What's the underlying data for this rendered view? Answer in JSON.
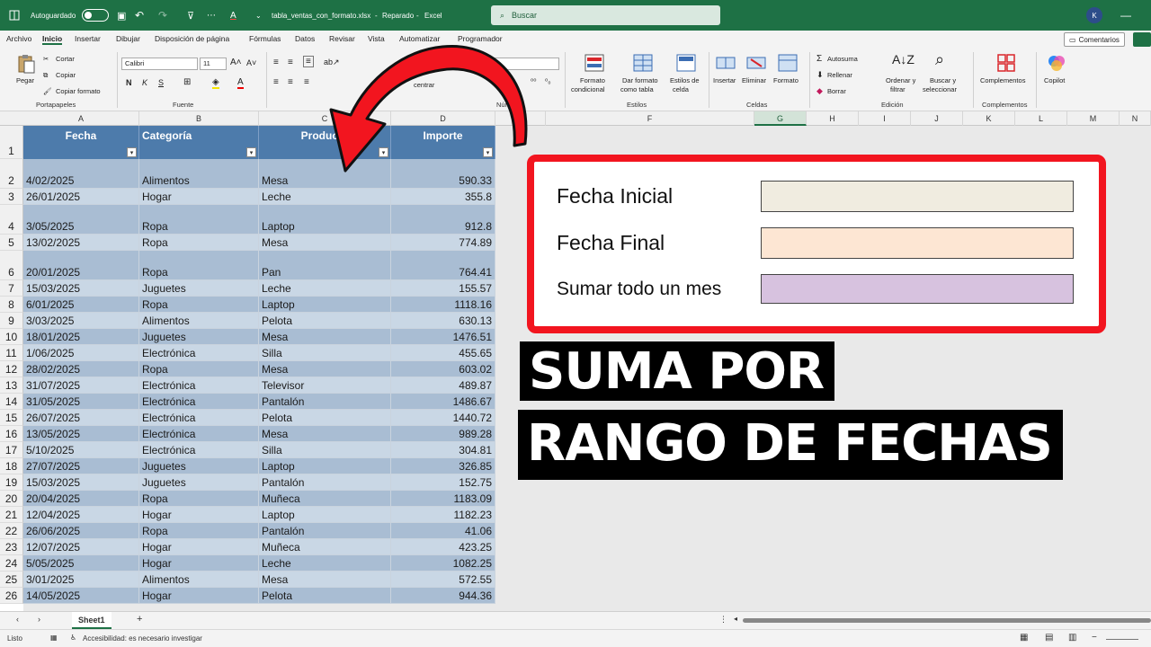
{
  "titlebar": {
    "autosave_label": "Autoguardado",
    "filename": "tabla_ventas_con_formato.xlsx",
    "status": "Reparado",
    "app": "Excel",
    "search_placeholder": "Buscar",
    "avatar_initial": "K"
  },
  "menu": {
    "tabs": [
      "Archivo",
      "Inicio",
      "Insertar",
      "Dibujar",
      "Disposición de página",
      "Fórmulas",
      "Datos",
      "Revisar",
      "Vista",
      "Automatizar",
      "Programador"
    ],
    "active": "Inicio",
    "comments_label": "Comentarios"
  },
  "ribbon": {
    "paste": "Pegar",
    "cut": "Cortar",
    "copy": "Copiar",
    "format_painter": "Copiar formato",
    "clipboard_group": "Portapapeles",
    "font_name": "Calibri",
    "font_size": "11",
    "font_group": "Fuente",
    "align_center_label": "centrar",
    "number_format": "General",
    "number_group": "Número",
    "cond_format_1": "Formato",
    "cond_format_2": "condicional",
    "format_table_1": "Dar formato",
    "format_table_2": "como tabla",
    "cell_styles_1": "Estilos de",
    "cell_styles_2": "celda",
    "styles_group": "Estilos",
    "insert": "Insertar",
    "delete": "Eliminar",
    "format": "Formato",
    "cells_group": "Celdas",
    "autosum": "Autosuma",
    "fill": "Rellenar",
    "clear": "Borrar",
    "sort_1": "Ordenar y",
    "sort_2": "filtrar",
    "find_1": "Buscar y",
    "find_2": "seleccionar",
    "edit_group": "Edición",
    "addins": "Complementos",
    "addins_group": "Complementos",
    "copilot": "Copilot"
  },
  "columns": [
    "A",
    "B",
    "C",
    "D",
    "E",
    "F",
    "G",
    "H",
    "I",
    "J",
    "K",
    "L",
    "M",
    "N"
  ],
  "selected_column": "G",
  "table": {
    "headers": [
      "Fecha",
      "Categoría",
      "Producto",
      "Importe"
    ],
    "rows": [
      [
        "4/02/2025",
        "Alimentos",
        "Mesa",
        "590.33"
      ],
      [
        "26/01/2025",
        "Hogar",
        "Leche",
        "355.8"
      ],
      [
        "3/05/2025",
        "Ropa",
        "Laptop",
        "912.8"
      ],
      [
        "13/02/2025",
        "Ropa",
        "Mesa",
        "774.89"
      ],
      [
        "20/01/2025",
        "Ropa",
        "Pan",
        "764.41"
      ],
      [
        "15/03/2025",
        "Juguetes",
        "Leche",
        "155.57"
      ],
      [
        "6/01/2025",
        "Ropa",
        "Laptop",
        "1118.16"
      ],
      [
        "3/03/2025",
        "Alimentos",
        "Pelota",
        "630.13"
      ],
      [
        "18/01/2025",
        "Juguetes",
        "Mesa",
        "1476.51"
      ],
      [
        "1/06/2025",
        "Electrónica",
        "Silla",
        "455.65"
      ],
      [
        "28/02/2025",
        "Ropa",
        "Mesa",
        "603.02"
      ],
      [
        "31/07/2025",
        "Electrónica",
        "Televisor",
        "489.87"
      ],
      [
        "31/05/2025",
        "Electrónica",
        "Pantalón",
        "1486.67"
      ],
      [
        "26/07/2025",
        "Electrónica",
        "Pelota",
        "1440.72"
      ],
      [
        "13/05/2025",
        "Electrónica",
        "Mesa",
        "989.28"
      ],
      [
        "5/10/2025",
        "Electrónica",
        "Silla",
        "304.81"
      ],
      [
        "27/07/2025",
        "Juguetes",
        "Laptop",
        "326.85"
      ],
      [
        "15/03/2025",
        "Juguetes",
        "Pantalón",
        "152.75"
      ],
      [
        "20/04/2025",
        "Ropa",
        "Muñeca",
        "1183.09"
      ],
      [
        "12/04/2025",
        "Hogar",
        "Laptop",
        "1182.23"
      ],
      [
        "26/06/2025",
        "Ropa",
        "Pantalón",
        "41.06"
      ],
      [
        "12/07/2025",
        "Hogar",
        "Muñeca",
        "423.25"
      ],
      [
        "5/05/2025",
        "Hogar",
        "Leche",
        "1082.25"
      ],
      [
        "3/01/2025",
        "Alimentos",
        "Mesa",
        "572.55"
      ],
      [
        "14/05/2025",
        "Hogar",
        "Pelota",
        "944.36"
      ]
    ]
  },
  "row_numbers": [
    "1",
    "2",
    "3",
    "4",
    "5",
    "6",
    "7",
    "8",
    "9",
    "10",
    "11",
    "12",
    "13",
    "14",
    "15",
    "16",
    "17",
    "18",
    "19",
    "20",
    "21",
    "22",
    "23",
    "24",
    "25",
    "26"
  ],
  "panel": {
    "start_label": "Fecha Inicial",
    "end_label": "Fecha Final",
    "month_label": "Sumar todo un mes",
    "start_color": "#f0ece0",
    "end_color": "#fde6d3",
    "month_color": "#d7c2df"
  },
  "headline": {
    "line1": "SUMA POR",
    "line2": "RANGO DE FECHAS"
  },
  "sheetbar": {
    "sheet_name": "Sheet1",
    "add_label": "+"
  },
  "status": {
    "ready": "Listo",
    "accessibility": "Accesibilidad: es necesario investigar"
  },
  "colors": {
    "excel_green": "#1e7145",
    "table_header": "#4d7bab",
    "row_dark": "#a9bdd3",
    "row_light": "#c9d7e5",
    "highlight_red": "#f2151f"
  }
}
